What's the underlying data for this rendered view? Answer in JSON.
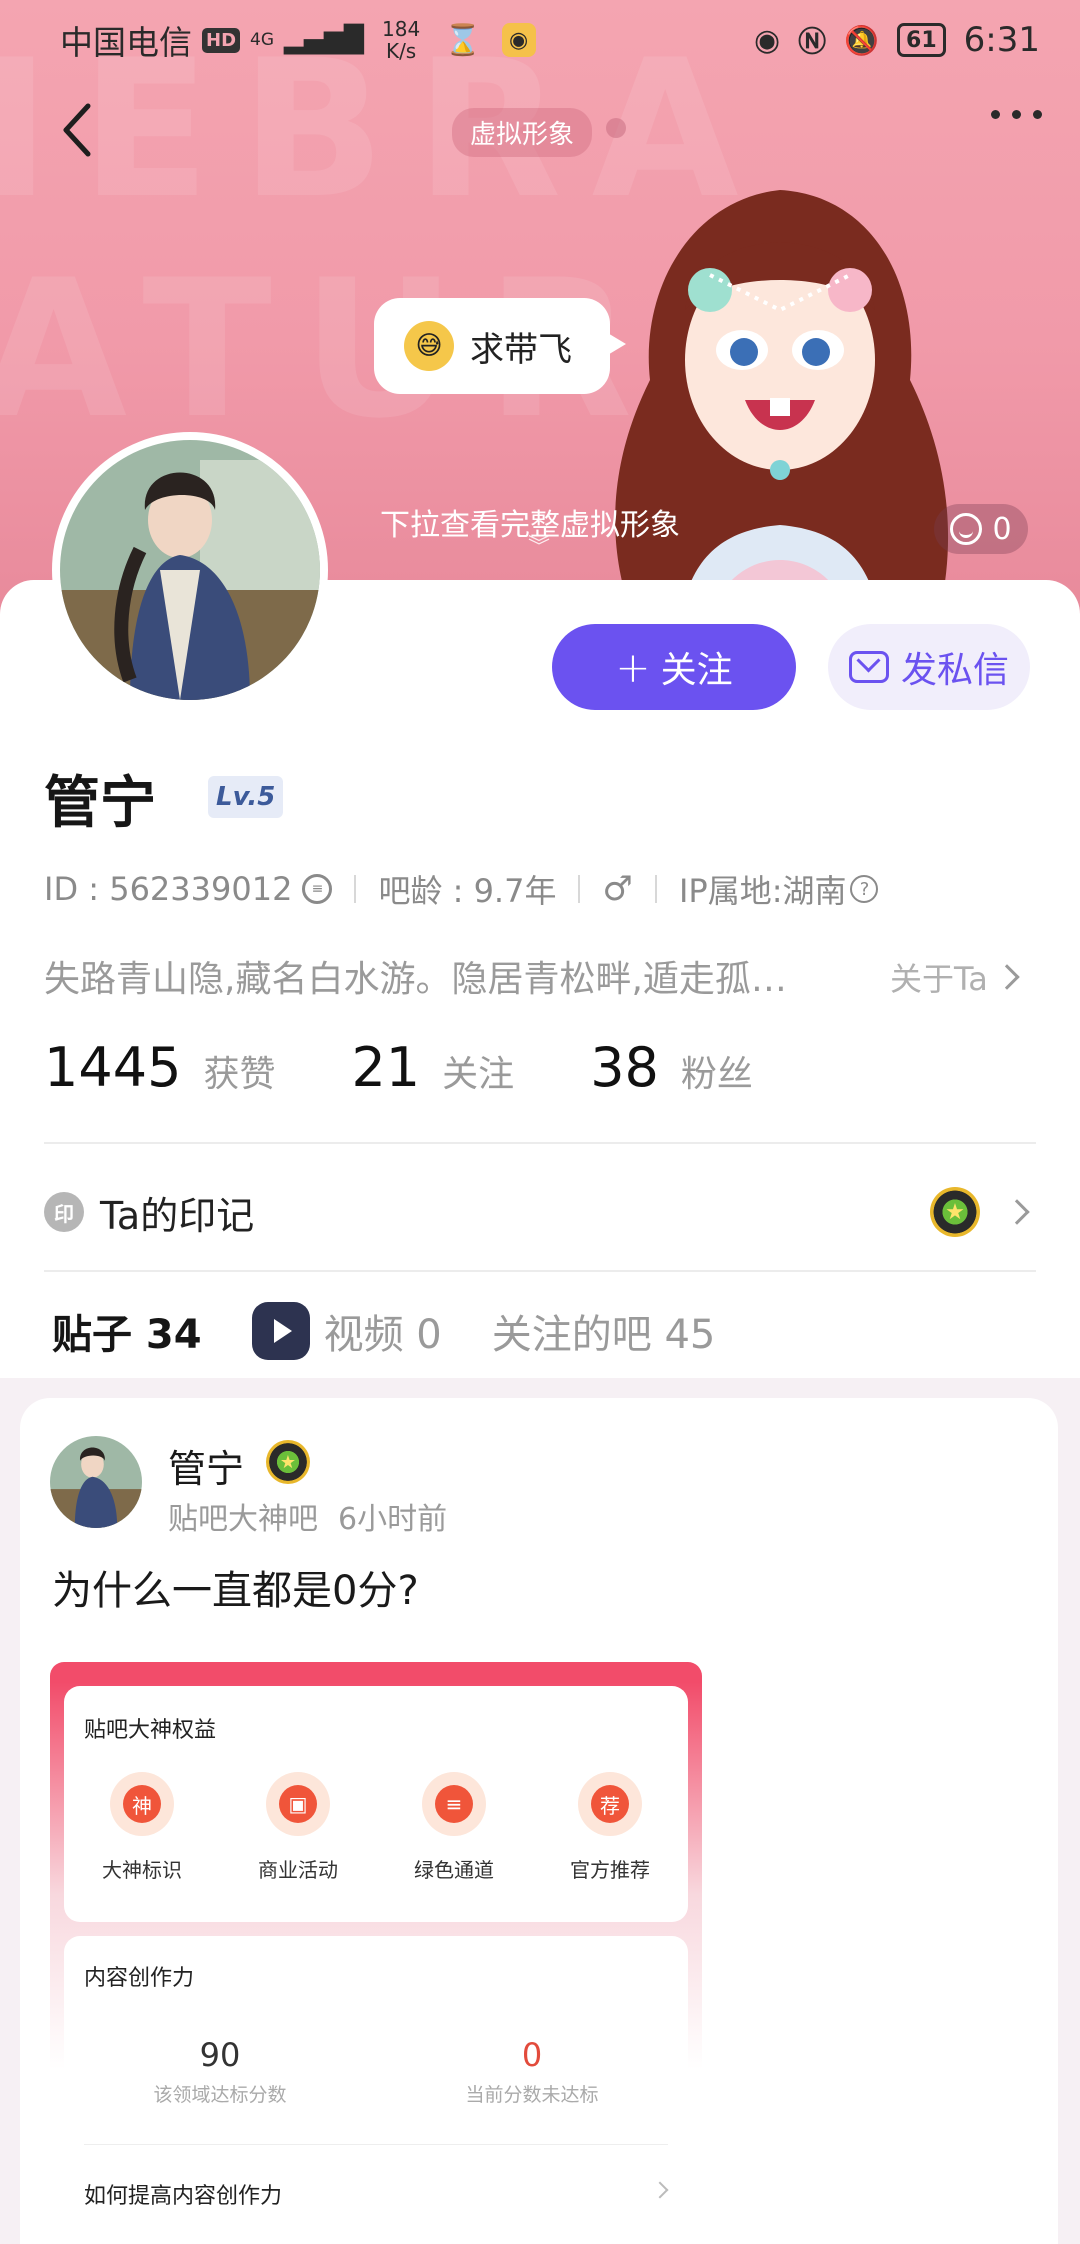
{
  "status_bar": {
    "carrier": "中国电信",
    "hd": "HD",
    "network": "4G",
    "speed_value": "184",
    "speed_unit": "K/s",
    "battery": "61",
    "time": "6:31"
  },
  "header": {
    "avatar_pill": "虚拟形象",
    "speech_text": "求带飞",
    "pull_hint": "下拉查看完整虚拟形象",
    "like_count": "0"
  },
  "profile": {
    "follow_label": "关注",
    "message_label": "发私信",
    "name": "管宁",
    "level": "Lv.5",
    "id_text": "ID : 562339012",
    "age_text": "吧龄 : 9.7年",
    "gender_symbol": "♂",
    "ip_text": "IP属地:湖南",
    "bio": "失路青山隐,藏名白水游。隐居青松畔,遁走孤…",
    "about_label": "关于Ta",
    "stats": [
      {
        "num": "1445",
        "label": "获赞"
      },
      {
        "num": "21",
        "label": "关注"
      },
      {
        "num": "38",
        "label": "粉丝"
      }
    ],
    "seal_icon": "印",
    "seal_label": "Ta的印记"
  },
  "tabs": [
    {
      "label": "贴子 34"
    },
    {
      "label": "视频 0"
    },
    {
      "label": "关注的吧 45"
    }
  ],
  "post": {
    "author": "管宁",
    "bar": "贴吧大神吧",
    "time": "6小时前",
    "title": "为什么一直都是0分?",
    "shot": {
      "title": "贴吧大神权益",
      "perks": [
        {
          "icon": "神",
          "label": "大神标识"
        },
        {
          "icon": "▣",
          "label": "商业活动"
        },
        {
          "icon": "≡",
          "label": "绿色通道"
        },
        {
          "icon": "荐",
          "label": "官方推荐"
        }
      ],
      "section2_title": "内容创作力",
      "score_required": "90",
      "score_required_label": "该领域达标分数",
      "score_current": "0",
      "score_current_label": "当前分数未达标",
      "improve_label": "如何提高内容创作力"
    }
  }
}
